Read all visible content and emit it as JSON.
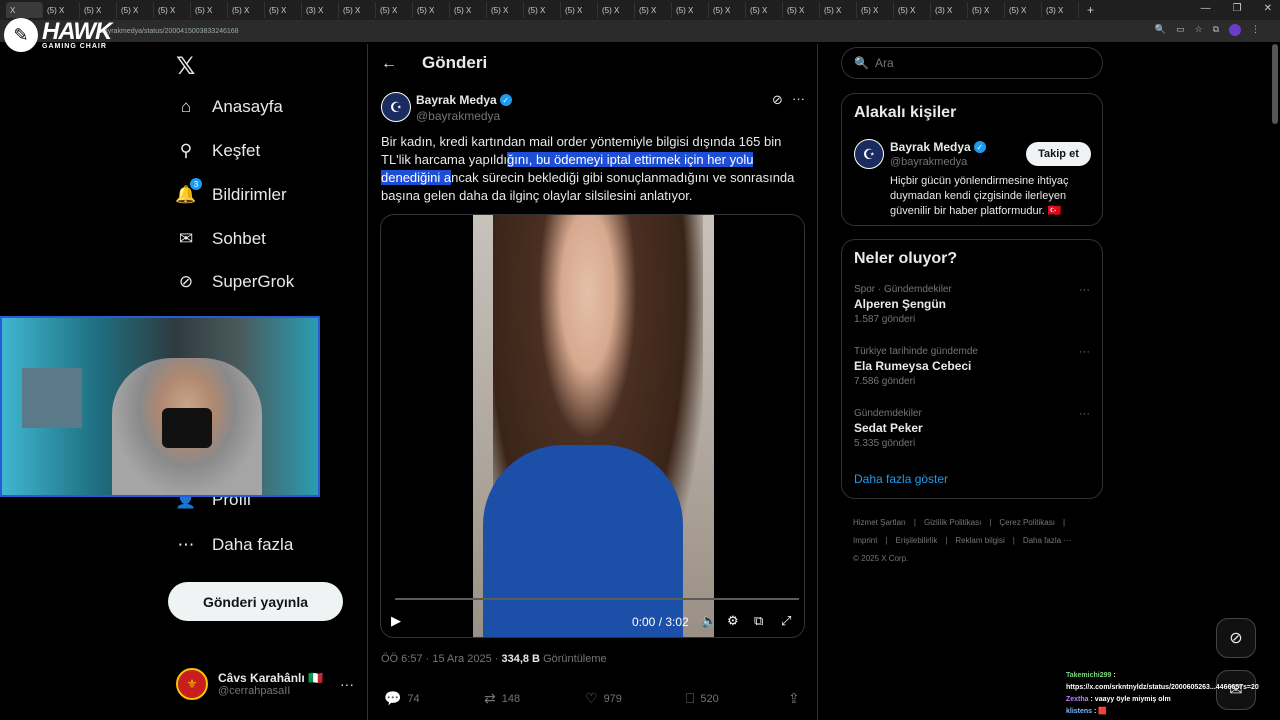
{
  "browser": {
    "tabs": [
      "X",
      "(5) X",
      "(5) X",
      "(5) X",
      "(5) X",
      "(5) X",
      "(5) X",
      "(5) X",
      "(3) X",
      "(5) X",
      "(5) X",
      "(5) X",
      "(5) X",
      "(5) X",
      "(5) X",
      "(5) X",
      "(5) X",
      "(5) X",
      "(5) X",
      "(5) X",
      "(5) X",
      "(5) X",
      "(5) X",
      "(5) X",
      "(5) X",
      "(3) X",
      "(5) X",
      "(5) X",
      "(3) X"
    ],
    "active_tab": "X",
    "url": "bayrakmedya/status/2000415003833246168"
  },
  "overlay_logo": {
    "main": "HAWK",
    "sub": "GAMING CHAIR"
  },
  "nav": {
    "items": [
      {
        "label": "Anasayfa",
        "icon": "home-icon"
      },
      {
        "label": "Keşfet",
        "icon": "search-icon"
      },
      {
        "label": "Bildirimler",
        "icon": "bell-icon",
        "badge": "3"
      },
      {
        "label": "Sohbet",
        "icon": "mail-icon"
      },
      {
        "label": "SuperGrok",
        "icon": "grok-icon"
      },
      {
        "label": "Profil",
        "icon": "person-icon"
      },
      {
        "label": "Daha fazla",
        "icon": "more-circle-icon"
      }
    ],
    "post_button": "Gönderi yayınla",
    "me": {
      "name": "Câvs Karahânlı 🇮🇹",
      "handle": "@cerrahpasaII"
    }
  },
  "post": {
    "page_title": "Gönderi",
    "author": {
      "name": "Bayrak Medya",
      "handle": "@bayrakmedya"
    },
    "text_before": "Bir kadın, kredi kartından mail order yöntemiyle bilgisi dışında 165 bin TL'lik harcama yapıldı",
    "text_highlight": "ğını, bu ödemeyi iptal ettirmek için her yolu denediğini a",
    "text_after": "ncak sürecin beklediği gibi sonuçlanmadığını ve sonrasında başına gelen daha da ilginç olaylar silsilesini anlatıyor.",
    "video": {
      "time": "0:00 / 3:02",
      "progress": 0
    },
    "time": "ÖÖ 6:57 · 15 Ara 2025 ·",
    "views": "334,8 B",
    "views_label": "Görüntüleme",
    "stats": {
      "replies": "74",
      "reposts": "148",
      "likes": "979",
      "bookmarks": "520"
    }
  },
  "sidebar": {
    "search_placeholder": "Ara",
    "related": {
      "title": "Alakalı kişiler",
      "name": "Bayrak Medya",
      "handle": "@bayrakmedya",
      "follow": "Takip et",
      "bio": "Hiçbir gücün yönlendirmesine ihtiyaç duymadan kendi çizgisinde ilerleyen güvenilir bir haber platformudur. 🇹🇷"
    },
    "trends": {
      "title": "Neler oluyor?",
      "items": [
        {
          "context": "Spor · Gündemdekiler",
          "name": "Alperen Şengün",
          "count": "1.587 gönderi"
        },
        {
          "context": "Türkiye tarihinde gündemde",
          "name": "Ela Rumeysa Cebeci",
          "count": "7.586 gönderi"
        },
        {
          "context": "Gündemdekiler",
          "name": "Sedat Peker",
          "count": "5.335 gönderi"
        }
      ],
      "show_more": "Daha fazla göster"
    },
    "footer": [
      "Hizmet Şartları",
      "|",
      "Gizlilik Politikası",
      "|",
      "Çerez Politikası",
      "|",
      "Imprint",
      "|",
      "Erişilebilirlik",
      "|",
      "Reklam bilgisi",
      "|",
      "Daha fazla ···",
      "© 2025 X Corp."
    ]
  },
  "chat": [
    {
      "user": "Takemichi299",
      "msg": "https://x.com/srkntnyldz/status/2000605263...4466657s=20"
    },
    {
      "user": "Zextha",
      "msg": "vaayy öyle miymiş olm"
    },
    {
      "user": "klistens",
      "msg": "🟥"
    }
  ]
}
